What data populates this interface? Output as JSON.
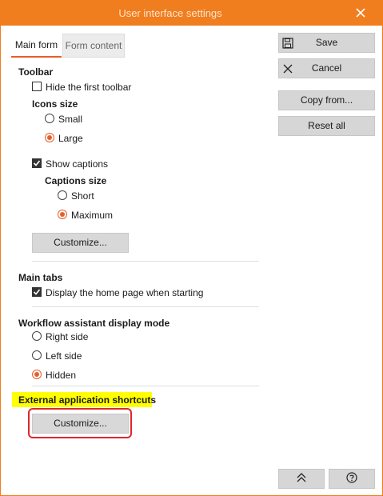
{
  "window": {
    "title": "User interface settings"
  },
  "icons": {
    "close": "close-icon",
    "save": "floppy-disk-icon",
    "cancel": "x-icon",
    "scroll_top": "double-chevron-up-icon",
    "help": "question-circle-icon"
  },
  "colors": {
    "accent": "#f07d1e",
    "radio_selected": "#e85e2b",
    "highlight": "#ffff00",
    "callout": "#e0262d"
  },
  "tabs": [
    {
      "label": "Main form",
      "active": true
    },
    {
      "label": "Form content",
      "active": false
    }
  ],
  "toolbar": {
    "title": "Toolbar",
    "hide_first_toolbar": {
      "label": "Hide the first toolbar",
      "checked": false
    },
    "icons_size": {
      "title": "Icons size",
      "options": [
        {
          "label": "Small",
          "selected": false
        },
        {
          "label": "Large",
          "selected": true
        }
      ]
    },
    "show_captions": {
      "label": "Show captions",
      "checked": true
    },
    "captions_size": {
      "title": "Captions size",
      "options": [
        {
          "label": "Short",
          "selected": false
        },
        {
          "label": "Maximum",
          "selected": true
        }
      ]
    },
    "customize_label": "Customize..."
  },
  "main_tabs": {
    "title": "Main tabs",
    "display_home": {
      "label": "Display the home page when starting",
      "checked": true
    }
  },
  "workflow": {
    "title": "Workflow assistant display mode",
    "options": [
      {
        "label": "Right side",
        "selected": false
      },
      {
        "label": "Left side",
        "selected": false
      },
      {
        "label": "Hidden",
        "selected": true
      }
    ]
  },
  "external": {
    "title": "External application shortcuts",
    "customize_label": "Customize..."
  },
  "actions": {
    "save": "Save",
    "cancel": "Cancel",
    "copy_from": "Copy from...",
    "reset_all": "Reset all"
  }
}
